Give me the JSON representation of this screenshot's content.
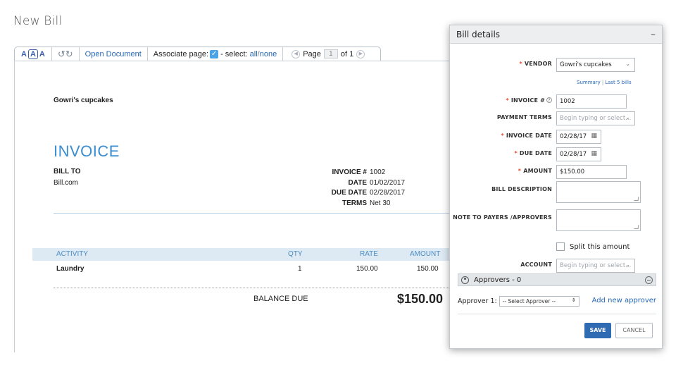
{
  "page": {
    "title": "New Bill"
  },
  "toolbar": {
    "font_sizes": [
      "A",
      "A",
      "A"
    ],
    "rotate_icons": "rotate-icons",
    "open_document": "Open Document",
    "associate_page": "Associate page:",
    "select_prefix": " - select:",
    "select_all": "all",
    "select_sep": "/",
    "select_none": "none",
    "page_label": "Page",
    "page_value": "1",
    "page_of": "of 1"
  },
  "document": {
    "company": "Gowri's cupcakes",
    "title": "INVOICE",
    "bill_to_label": "BILL TO",
    "bill_to_value": "Bill.com",
    "meta": [
      {
        "key": "INVOICE #",
        "value": "1002"
      },
      {
        "key": "DATE",
        "value": "01/02/2017"
      },
      {
        "key": "DUE DATE",
        "value": "02/28/2017"
      },
      {
        "key": "TERMS",
        "value": "Net 30"
      }
    ],
    "columns": {
      "activity": "ACTIVITY",
      "qty": "QTY",
      "rate": "RATE",
      "amount": "AMOUNT"
    },
    "line_item": {
      "activity": "Laundry",
      "qty": "1",
      "rate": "150.00",
      "amount": "150.00"
    },
    "balance_label": "BALANCE DUE",
    "balance_value": "$150.00"
  },
  "panel": {
    "title": "Bill details",
    "minimize": "–",
    "vendor_label": "VENDOR",
    "vendor_value": "Gowri's cupcakes",
    "summary_link": "Summary",
    "last5_link": "Last 5 bills",
    "invoice_label": "INVOICE #",
    "invoice_value": "1002",
    "terms_label": "PAYMENT TERMS",
    "terms_placeholder": "Begin typing or select...",
    "invoice_date_label": "INVOICE DATE",
    "invoice_date_value": "02/28/17",
    "due_date_label": "DUE DATE",
    "due_date_value": "02/28/17",
    "amount_label": "AMOUNT",
    "amount_value": "$150.00",
    "description_label": "BILL DESCRIPTION",
    "note_label": "NOTE TO PAYERS /APPROVERS",
    "split_label": "Split this amount",
    "account_label": "ACCOUNT",
    "account_placeholder": "Begin typing or select...",
    "approvers_header": "Approvers - 0",
    "approver1_label": "Approver 1:",
    "approver1_select": "-- Select Approver --",
    "add_approver": "Add new approver",
    "save": "SAVE",
    "cancel": "CANCEL"
  },
  "colors": {
    "accent": "#2f6bb3",
    "required": "#e54a2d",
    "invoice_title": "#3b8ed0"
  }
}
